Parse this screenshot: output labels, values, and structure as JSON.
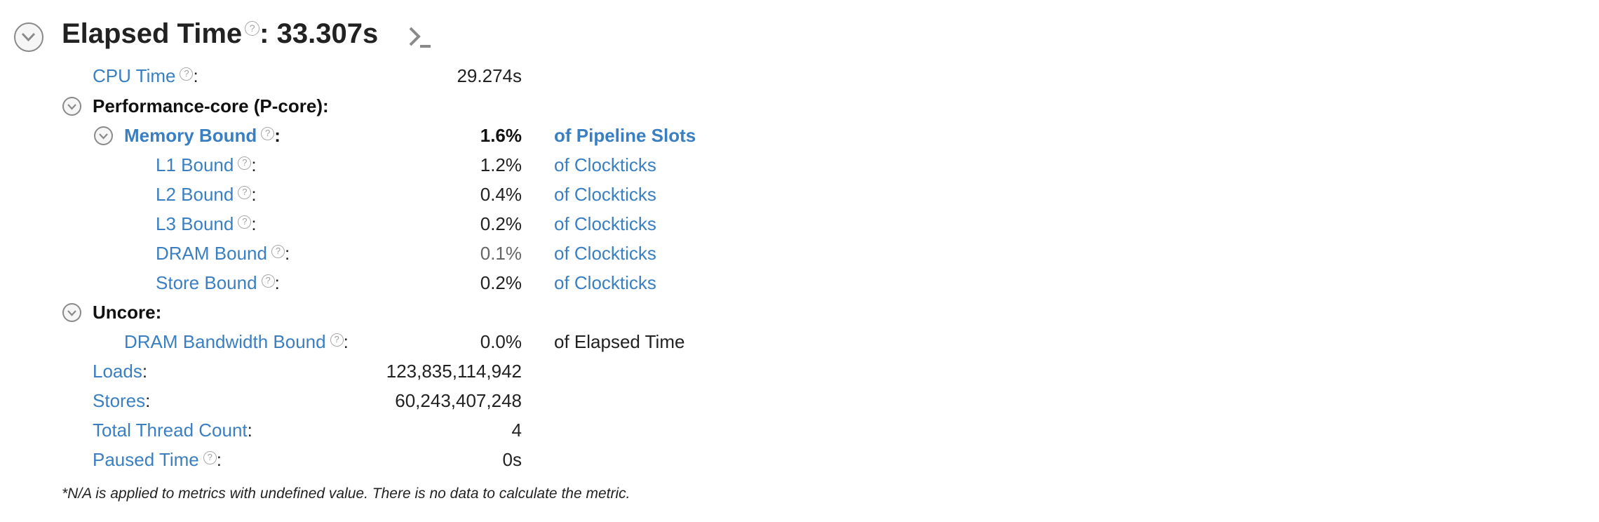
{
  "header": {
    "title": "Elapsed Time",
    "separator": ":",
    "value": "33.307s",
    "help_icon": "question-circle-icon",
    "command_icon": "command-line-icon"
  },
  "metrics": {
    "cpu_time": {
      "label": "CPU Time",
      "value": "29.274s"
    },
    "pcore": {
      "label": "Performance-core (P-core):"
    },
    "memory_bound": {
      "label": "Memory Bound",
      "value": "1.6%",
      "unit": "of Pipeline Slots"
    },
    "l1_bound": {
      "label": "L1 Bound",
      "value": "1.2%",
      "unit": "of Clockticks"
    },
    "l2_bound": {
      "label": "L2 Bound",
      "value": "0.4%",
      "unit": "of Clockticks"
    },
    "l3_bound": {
      "label": "L3 Bound",
      "value": "0.2%",
      "unit": "of Clockticks"
    },
    "dram_bound": {
      "label": "DRAM Bound",
      "value": "0.1%",
      "unit": "of Clockticks"
    },
    "store_bound": {
      "label": "Store Bound",
      "value": "0.2%",
      "unit": "of Clockticks"
    },
    "uncore": {
      "label": "Uncore:"
    },
    "dram_bw_bound": {
      "label": "DRAM Bandwidth Bound",
      "value": "0.0%",
      "unit": "of Elapsed Time"
    },
    "loads": {
      "label": "Loads",
      "value": "123,835,114,942"
    },
    "stores": {
      "label": "Stores",
      "value": "60,243,407,248"
    },
    "thread_count": {
      "label": "Total Thread Count",
      "value": "4"
    },
    "paused_time": {
      "label": "Paused Time",
      "value": "0s"
    }
  },
  "colon": ":",
  "help_glyph": "?",
  "footnote": "*N/A is applied to metrics with undefined value. There is no data to calculate the metric.",
  "colors": {
    "link_blue": "#3a7fc1",
    "text_dark": "#222222",
    "toggle_grey": "#8a8a8a"
  }
}
